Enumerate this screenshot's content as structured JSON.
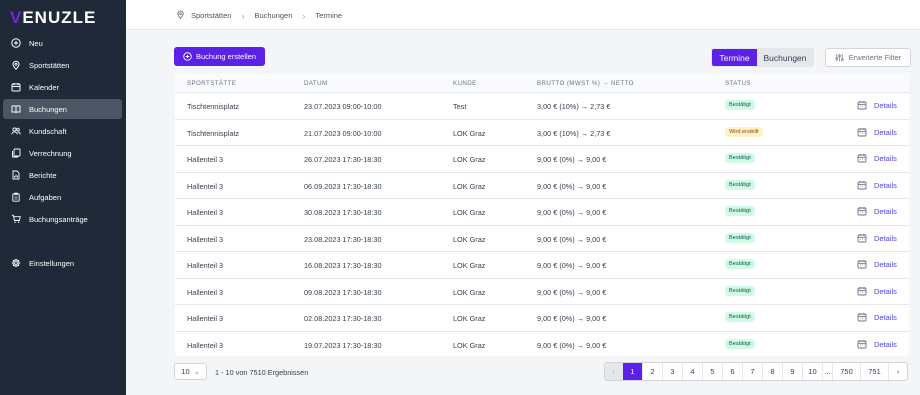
{
  "app": {
    "logo": "VENUZLE"
  },
  "sidebar": {
    "items": [
      {
        "label": "Neu",
        "icon": "plus-circle-icon"
      },
      {
        "label": "Sportstätten",
        "icon": "location-pin-icon"
      },
      {
        "label": "Kalender",
        "icon": "calendar-icon"
      },
      {
        "label": "Buchungen",
        "icon": "book-icon",
        "active": true
      },
      {
        "label": "Kundschaft",
        "icon": "users-icon"
      },
      {
        "label": "Verrechnung",
        "icon": "documents-icon"
      },
      {
        "label": "Berichte",
        "icon": "report-icon"
      },
      {
        "label": "Aufgaben",
        "icon": "clipboard-icon"
      },
      {
        "label": "Buchungsanträge",
        "icon": "cart-icon"
      },
      {
        "label": "Einstellungen",
        "icon": "gear-icon"
      }
    ]
  },
  "breadcrumb": [
    "Sportstätten",
    "Buchungen",
    "Termine"
  ],
  "toolbar": {
    "create_label": "Buchung erstellen",
    "view_termine": "Termine",
    "view_buchungen": "Buchungen",
    "filter_label": "Erweiterte Filter"
  },
  "table": {
    "headers": [
      "Sportstätte",
      "Datum",
      "Kunde",
      "Brutto (Mwst %) → Netto",
      "Status"
    ],
    "details_label": "Details",
    "rows": [
      {
        "venue": "Tischtennisplatz",
        "date": "23.07.2023 09:00-10:00",
        "customer": "Test",
        "price": "3,00 € (10%) → 2,73 €",
        "status": "Bestätigt",
        "status_type": "ok"
      },
      {
        "venue": "Tischtennisplatz",
        "date": "21.07.2023 09:00-10:00",
        "customer": "LOK Graz",
        "price": "3,00 € (10%) → 2,73 €",
        "status": "Wird erstellt",
        "status_type": "wip"
      },
      {
        "venue": "Hallenteil 3",
        "date": "26.07.2023 17:30-18:30",
        "customer": "LOK Graz",
        "price": "9,00 € (0%) → 9,00 €",
        "status": "Bestätigt",
        "status_type": "ok"
      },
      {
        "venue": "Hallenteil 3",
        "date": "06.09.2023 17:30-18:30",
        "customer": "LOK Graz",
        "price": "9,00 € (0%) → 9,00 €",
        "status": "Bestätigt",
        "status_type": "ok"
      },
      {
        "venue": "Hallenteil 3",
        "date": "30.08.2023 17:30-18:30",
        "customer": "LOK Graz",
        "price": "9,00 € (0%) → 9,00 €",
        "status": "Bestätigt",
        "status_type": "ok"
      },
      {
        "venue": "Hallenteil 3",
        "date": "23.08.2023 17:30-18:30",
        "customer": "LOK Graz",
        "price": "9,00 € (0%) → 9,00 €",
        "status": "Bestätigt",
        "status_type": "ok"
      },
      {
        "venue": "Hallenteil 3",
        "date": "16.08.2023 17:30-18:30",
        "customer": "LOK Graz",
        "price": "9,00 € (0%) → 9,00 €",
        "status": "Bestätigt",
        "status_type": "ok"
      },
      {
        "venue": "Hallenteil 3",
        "date": "09.08.2023 17:30-18:30",
        "customer": "LOK Graz",
        "price": "9,00 € (0%) → 9,00 €",
        "status": "Bestätigt",
        "status_type": "ok"
      },
      {
        "venue": "Hallenteil 3",
        "date": "02.08.2023 17:30-18:30",
        "customer": "LOK Graz",
        "price": "9,00 € (0%) → 9,00 €",
        "status": "Bestätigt",
        "status_type": "ok"
      },
      {
        "venue": "Hallenteil 3",
        "date": "19.07.2023 17:30-18:30",
        "customer": "LOK Graz",
        "price": "9,00 € (0%) → 9,00 €",
        "status": "Bestätigt",
        "status_type": "ok"
      }
    ]
  },
  "footer": {
    "per_page": "10",
    "results_text": "1 - 10 von 7510 Ergebnissen",
    "pages": [
      "1",
      "2",
      "3",
      "4",
      "5",
      "6",
      "7",
      "8",
      "9",
      "10",
      "...",
      "750",
      "751"
    ],
    "current_page": "1"
  },
  "colors": {
    "accent": "#5b21e6",
    "sidebar": "#1f2937",
    "link": "#4f46e5"
  }
}
